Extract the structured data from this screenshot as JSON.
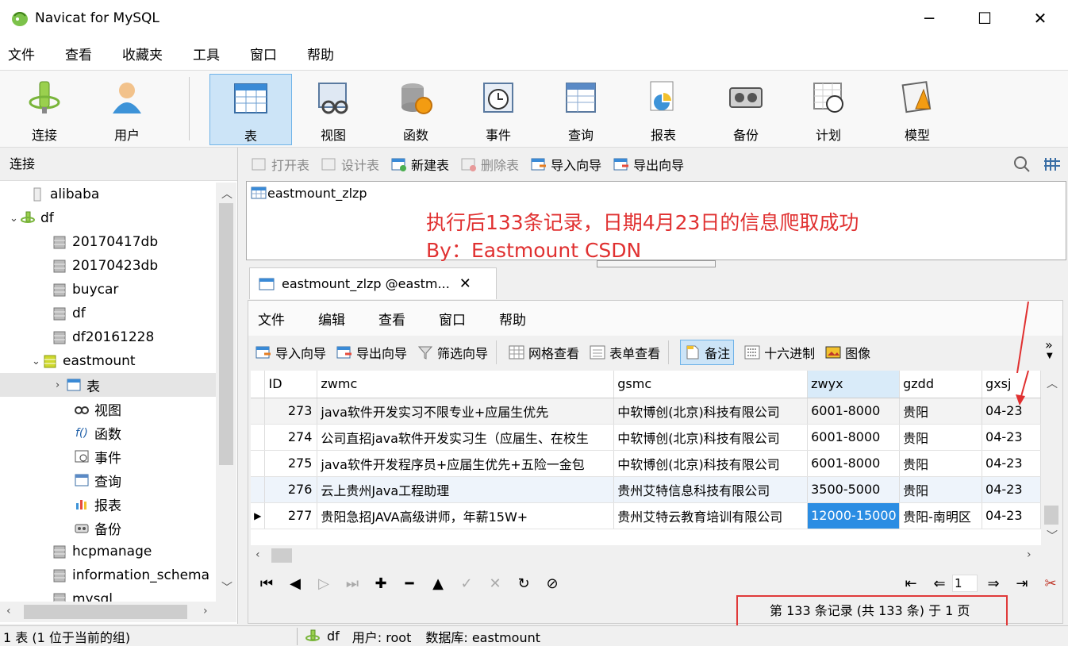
{
  "window": {
    "title": "Navicat for MySQL",
    "minimize": "─",
    "maximize": "☐",
    "close": "✕"
  },
  "menu": [
    "文件",
    "查看",
    "收藏夹",
    "工具",
    "窗口",
    "帮助"
  ],
  "toolbar": {
    "items": [
      {
        "label": "连接",
        "icon": "connect-icon"
      },
      {
        "label": "用户",
        "icon": "user-icon"
      },
      {
        "label": "表",
        "icon": "table-icon",
        "active": true
      },
      {
        "label": "视图",
        "icon": "view-icon"
      },
      {
        "label": "函数",
        "icon": "function-icon"
      },
      {
        "label": "事件",
        "icon": "event-icon"
      },
      {
        "label": "查询",
        "icon": "query-icon"
      },
      {
        "label": "报表",
        "icon": "report-icon"
      },
      {
        "label": "备份",
        "icon": "backup-icon"
      },
      {
        "label": "计划",
        "icon": "schedule-icon"
      },
      {
        "label": "模型",
        "icon": "model-icon"
      }
    ]
  },
  "left_panel": {
    "header": "连接",
    "tree": [
      {
        "label": "alibaba",
        "level": 1,
        "icon": "db-closed-icon"
      },
      {
        "label": "df",
        "level": 0,
        "icon": "connection-icon",
        "expanded": true
      },
      {
        "label": "20170417db",
        "level": 2,
        "icon": "db-icon"
      },
      {
        "label": "20170423db",
        "level": 2,
        "icon": "db-icon"
      },
      {
        "label": "buycar",
        "level": 2,
        "icon": "db-icon"
      },
      {
        "label": "df",
        "level": 2,
        "icon": "db-icon"
      },
      {
        "label": "df20161228",
        "level": 2,
        "icon": "db-icon"
      },
      {
        "label": "eastmount",
        "level": 1,
        "icon": "db-open-icon",
        "expanded": true
      },
      {
        "label": "表",
        "level": 3,
        "icon": "table-icon",
        "selected": true
      },
      {
        "label": "视图",
        "level": 3,
        "icon": "view-icon"
      },
      {
        "label": "函数",
        "level": 3,
        "icon": "function-icon"
      },
      {
        "label": "事件",
        "level": 3,
        "icon": "event-icon"
      },
      {
        "label": "查询",
        "level": 3,
        "icon": "query-icon"
      },
      {
        "label": "报表",
        "level": 3,
        "icon": "report-icon"
      },
      {
        "label": "备份",
        "level": 3,
        "icon": "backup-icon"
      },
      {
        "label": "hcpmanage",
        "level": 2,
        "icon": "db-icon"
      },
      {
        "label": "information_schema",
        "level": 2,
        "icon": "db-icon"
      },
      {
        "label": "mysql",
        "level": 2,
        "icon": "db-icon"
      }
    ]
  },
  "object_toolbar": {
    "open": "打开表",
    "design": "设计表",
    "new": "新建表",
    "delete": "删除表",
    "import": "导入向导",
    "export": "导出向导"
  },
  "object_list": {
    "item": "eastmount_zlzp"
  },
  "annotation": {
    "line1": "执行后133条记录，日期4月23日的信息爬取成功",
    "line2": "By：Eastmount CSDN"
  },
  "tab": {
    "label": "eastmount_zlzp @eastm...",
    "close": "✕"
  },
  "editor_menu": [
    "文件",
    "编辑",
    "查看",
    "窗口",
    "帮助"
  ],
  "editor_toolbar": {
    "import": "导入向导",
    "export": "导出向导",
    "filter": "筛选向导",
    "grid_view": "网格查看",
    "form_view": "表单查看",
    "memo": "备注",
    "hex": "十六进制",
    "image": "图像",
    "more": "»"
  },
  "grid": {
    "columns": [
      "ID",
      "zwmc",
      "gsmc",
      "zwyx",
      "gzdd",
      "gxsj"
    ],
    "rows": [
      [
        "273",
        "java软件开发实习不限专业+应届生优先",
        "中软博创(北京)科技有限公司",
        "6001-8000",
        "贵阳",
        "04-23"
      ],
      [
        "274",
        "公司直招java软件开发实习生（应届生、在校生",
        "中软博创(北京)科技有限公司",
        "6001-8000",
        "贵阳",
        "04-23"
      ],
      [
        "275",
        "java软件开发程序员+应届生优先+五险一金包",
        "中软博创(北京)科技有限公司",
        "6001-8000",
        "贵阳",
        "04-23"
      ],
      [
        "276",
        "云上贵州Java工程助理",
        "贵州艾特信息科技有限公司",
        "3500-5000",
        "贵阳",
        "04-23"
      ],
      [
        "277",
        "贵阳急招JAVA高级讲师，年薪15W+",
        "贵州艾特云教育培训有限公司",
        "12000-15000",
        "贵阳-南明区",
        "04-23"
      ]
    ]
  },
  "pager": {
    "page": "1"
  },
  "record_info": "第 133 条记录 (共 133 条) 于 1 页",
  "status": {
    "left": "1 表 (1 位于当前的组)",
    "connection": "df",
    "user": "用户: root",
    "database": "数据库: eastmount"
  },
  "colors": {
    "annotation": "#e03030",
    "selected_cell": "#2b8de3",
    "active_button": "#cce4f7"
  }
}
